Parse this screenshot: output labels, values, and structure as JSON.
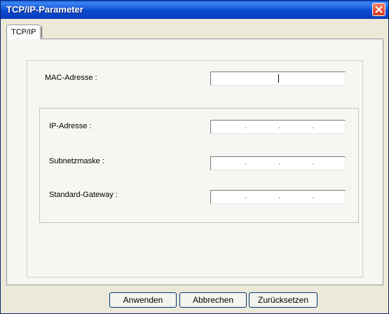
{
  "window": {
    "title": "TCP/IP-Parameter"
  },
  "tabs": [
    {
      "label": "TCP/IP"
    }
  ],
  "fields": {
    "mac": {
      "label": "MAC-Adresse :",
      "value": ""
    },
    "ip": {
      "label": "IP-Adresse :",
      "value": ". . ."
    },
    "subnet": {
      "label": "Subnetzmaske :",
      "value": ". . ."
    },
    "gateway": {
      "label": "Standard-Gateway :",
      "value": ". . ."
    }
  },
  "buttons": {
    "apply": "Anwenden",
    "cancel": "Abbrechen",
    "reset": "Zurücksetzen"
  },
  "icons": {
    "close": "close-icon"
  },
  "colors": {
    "titlebar": "#0b4ad3",
    "close_button": "#e2502f",
    "dialog_bg": "#ece9d8"
  }
}
